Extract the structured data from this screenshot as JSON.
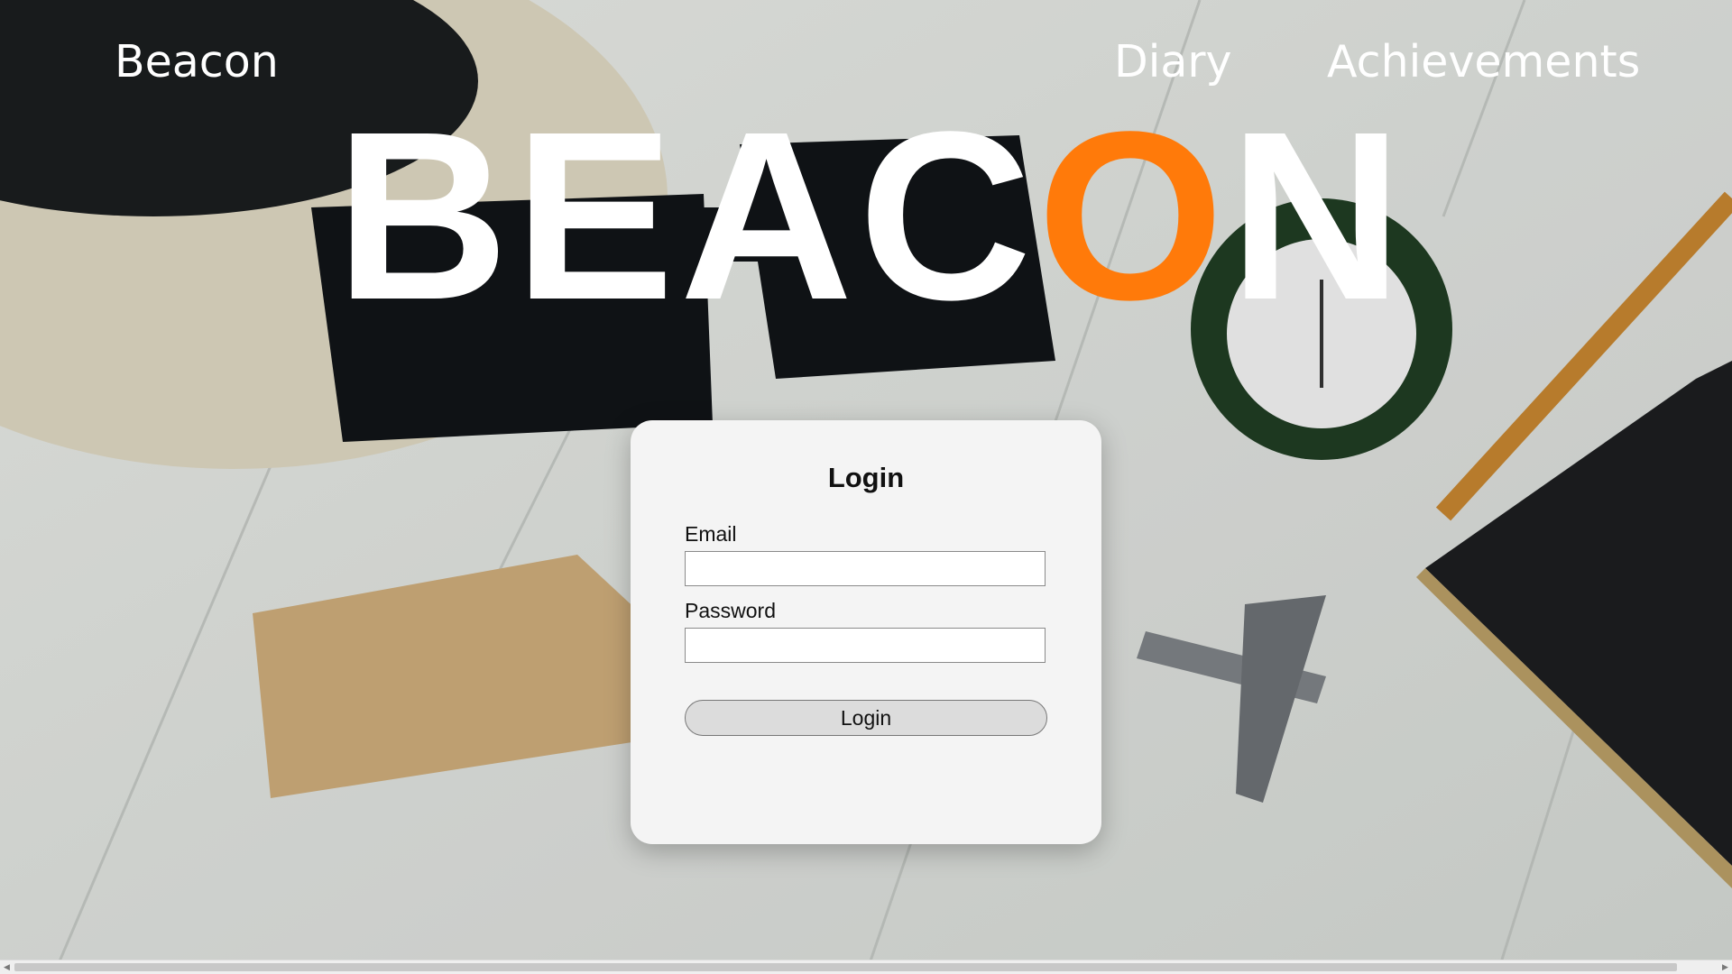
{
  "nav": {
    "brand": "Beacon",
    "links": [
      "Diary",
      "Achievements"
    ]
  },
  "hero": {
    "before": "BEAC",
    "accent_letter": "O",
    "after": "N"
  },
  "login": {
    "title": "Login",
    "email_label": "Email",
    "email_value": "",
    "password_label": "Password",
    "password_value": "",
    "button_label": "Login"
  },
  "colors": {
    "accent": "#ff7a0a",
    "text_light": "#ffffff",
    "card_background": "#f4f4f4"
  }
}
